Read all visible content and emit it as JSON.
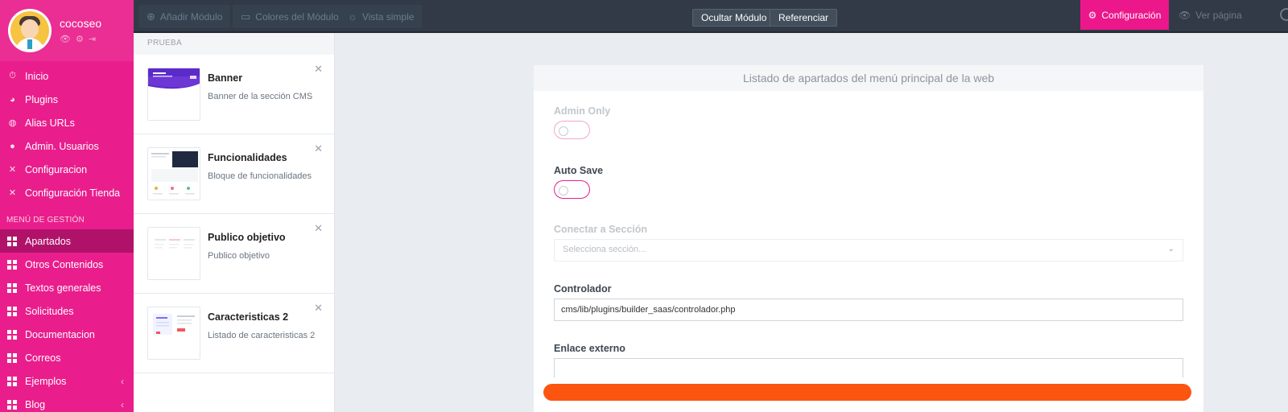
{
  "user": {
    "name": "cocoseo",
    "icons": [
      "eye-icon",
      "gear-icon",
      "logout-icon"
    ]
  },
  "nav": {
    "main": [
      {
        "label": "Inicio",
        "icon": "stopwatch-icon"
      },
      {
        "label": " Plugins",
        "icon": "palette-icon"
      },
      {
        "label": "Alias URLs",
        "icon": "globe-icon"
      },
      {
        "label": "Admin. Usuarios",
        "icon": "user-icon"
      },
      {
        "label": "Configuracion",
        "icon": "tools-icon"
      },
      {
        "label": "Configuración Tienda",
        "icon": "tools-icon"
      }
    ],
    "section_title": "MENÚ DE GESTIÓN",
    "gestion": [
      {
        "label": "Apartados",
        "active": true
      },
      {
        "label": "Otros Contenidos"
      },
      {
        "label": "Textos generales"
      },
      {
        "label": "Solicitudes"
      },
      {
        "label": "Documentacion"
      },
      {
        "label": "Correos"
      },
      {
        "label": "Ejemplos",
        "chevron": "‹"
      },
      {
        "label": "Blog",
        "chevron": "‹"
      }
    ]
  },
  "toolbar": {
    "add_module": "Añadir Módulo",
    "module_colors": "Colores del Módulo",
    "simple_view": "Vista simple",
    "hide_module": "Ocultar Módulo",
    "reference": "Referenciar",
    "configuration": "Configuración",
    "view_page": "Ver página"
  },
  "modules": {
    "group": "PRUEBA",
    "items": [
      {
        "title": "Banner",
        "desc": "Banner de la sección CMS"
      },
      {
        "title": "Funcionalidades",
        "desc": "Bloque de funcionalidades"
      },
      {
        "title": "Publico objetivo",
        "desc": "Publico objetivo"
      },
      {
        "title": "Caracteristicas 2",
        "desc": "Listado de caracteristicas 2"
      }
    ]
  },
  "form": {
    "title": "Listado de apartados del menú principal de la web",
    "admin_only": "Admin Only",
    "auto_save": "Auto Save",
    "connect_section": "Conectar a Sección",
    "section_placeholder": "Selecciona sección...",
    "controller_label": "Controlador",
    "controller_value": "cms/lib/plugins/builder_saas/controlador.php",
    "external_link_label": "Enlace externo",
    "external_link_value": ""
  },
  "colors": {
    "brand": "#e91e8c",
    "topbar": "#313a46",
    "save_bar": "#fc5510"
  }
}
